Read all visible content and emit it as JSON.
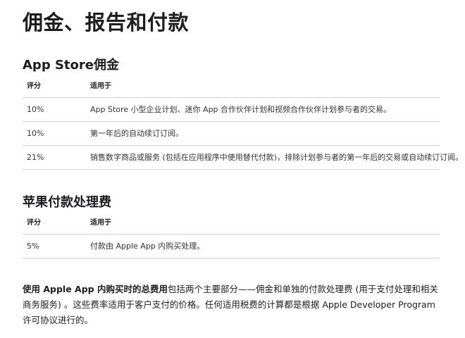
{
  "page_title": "佣金、报告和付款",
  "app_store_commission": {
    "heading": "App Store佣金",
    "columns": [
      "评分",
      "适用于"
    ],
    "rows": [
      {
        "rate": "10%",
        "applies_to": "App Store 小型企业计划、迷你 App 合作伙伴计划和视频合作伙伴计划参与者的交易。"
      },
      {
        "rate": "10%",
        "applies_to": "第一年后的自动续订订阅。"
      },
      {
        "rate": "21%",
        "applies_to": "销售数字商品或服务 (包括在应用程序中使用替代付款)，排除计划参与者的第一年后的交易或自动续订订阅。"
      }
    ]
  },
  "apple_payment_fee": {
    "heading": "苹果付款处理费",
    "columns": [
      "评分",
      "适用于"
    ],
    "rows": [
      {
        "rate": "5%",
        "applies_to": "付款由 Apple App 内购买处理。"
      }
    ]
  },
  "footer": {
    "strong": "使用 Apple App 内购买时的总费用",
    "text": "包括两个主要部分——佣金和单独的付款处理费 (用于支付处理和相关商务服务) 。这些费率适用于客户支付的价格。任何适用税费的计算都是根据 Apple Developer Program 许可协议进行的。"
  }
}
